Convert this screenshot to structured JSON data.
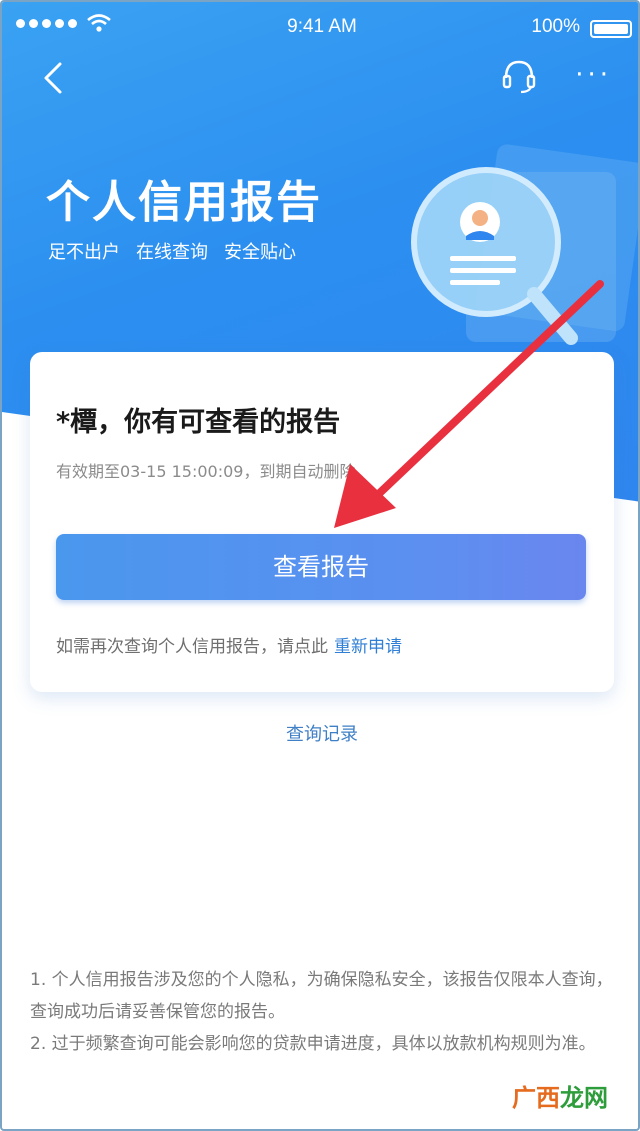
{
  "status_bar": {
    "time": "9:41 AM",
    "battery": "100%"
  },
  "nav": {
    "more_label": "···"
  },
  "hero": {
    "title": "个人信用报告",
    "subtitles": [
      "足不出户",
      "在线查询",
      "安全贴心"
    ]
  },
  "card": {
    "greeting": "*橝，你有可查看的报告",
    "validity": "有效期至03-15 15:00:09，到期自动删除",
    "view_button": "查看报告",
    "reapply_text": "如需再次查询个人信用报告，请点此",
    "reapply_link": "重新申请"
  },
  "history_link": "查询记录",
  "notes": [
    "1. 个人信用报告涉及您的个人隐私，为确保隐私安全，该报告仅限本人查询，查询成功后请妥善保管您的报告。",
    "2. 过于频繁查询可能会影响您的贷款申请进度，具体以放款机构规则为准。"
  ],
  "watermark": {
    "part1": "广西",
    "part2": "龙网"
  },
  "colors": {
    "hero": "#2c8ff0",
    "button": "#5c8ff0",
    "link": "#2f7fd6",
    "arrow": "#e8303f"
  }
}
